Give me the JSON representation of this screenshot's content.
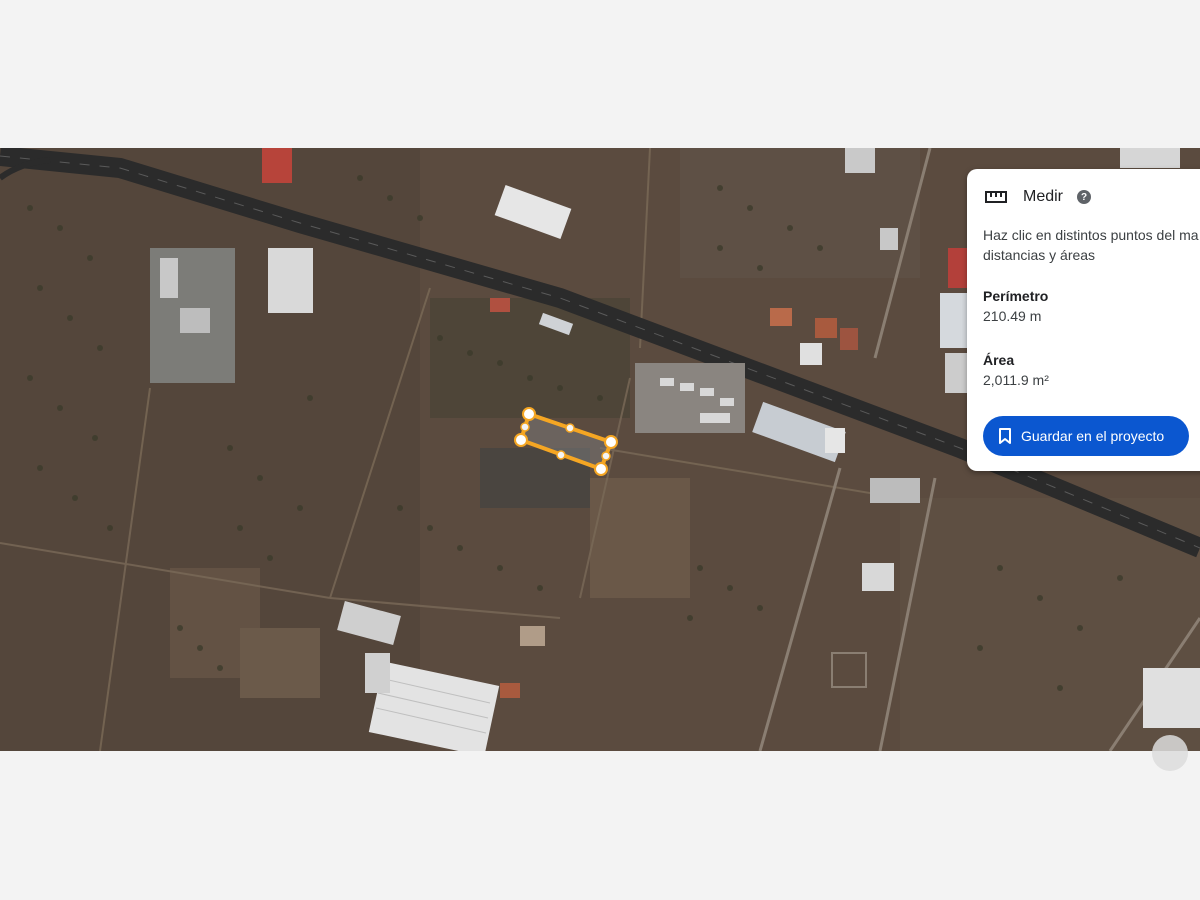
{
  "panel": {
    "title": "Medir",
    "help_icon": "help-icon",
    "description_line1": "Haz clic en distintos puntos del ma",
    "description_line2": "distancias y áreas",
    "perimeter_label": "Perímetro",
    "perimeter_value": "210.49 m",
    "area_label": "Área",
    "area_value": "2,011.9 m²",
    "save_button_label": "Guardar en el proyecto"
  },
  "icons": {
    "ruler": "ruler-icon",
    "bookmark": "bookmark-icon"
  },
  "colors": {
    "measure_outline": "#f5a623",
    "button_blue": "#0b57d0",
    "road": "#2b2b2b"
  }
}
